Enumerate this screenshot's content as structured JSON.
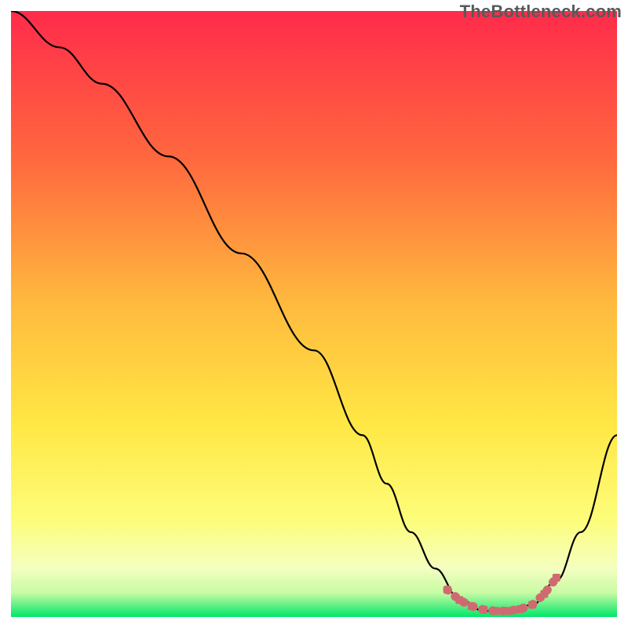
{
  "watermark": "TheBottleneck.com",
  "colors": {
    "gradient_top": "#ff2b4b",
    "gradient_mid1": "#ff8d3a",
    "gradient_mid2": "#ffe744",
    "gradient_mid3": "#fdfea0",
    "gradient_bottom": "#00e66a",
    "curve": "#000000",
    "curve_optimal": "#cf6b70",
    "axis": "#000000"
  },
  "chart_data": {
    "type": "line",
    "title": "",
    "xlabel": "",
    "ylabel": "",
    "xlim": [
      0,
      100
    ],
    "ylim": [
      0,
      100
    ],
    "series": [
      {
        "name": "bottleneck-curve",
        "x": [
          0,
          8,
          15,
          26,
          38,
          50,
          58,
          62,
          66,
          70,
          74,
          78,
          82,
          86,
          90,
          94,
          100
        ],
        "values": [
          100,
          94,
          88,
          76,
          60,
          44,
          30,
          22,
          14,
          8,
          3,
          1,
          1,
          2,
          6,
          14,
          30
        ]
      },
      {
        "name": "optimal-range-markers",
        "x": [
          72,
          74,
          76,
          78,
          80,
          82,
          84,
          86,
          88,
          90
        ],
        "values": [
          4.5,
          2.8,
          1.8,
          1.2,
          1.0,
          1.0,
          1.3,
          2.0,
          3.8,
          6.5
        ]
      }
    ],
    "annotations": []
  }
}
